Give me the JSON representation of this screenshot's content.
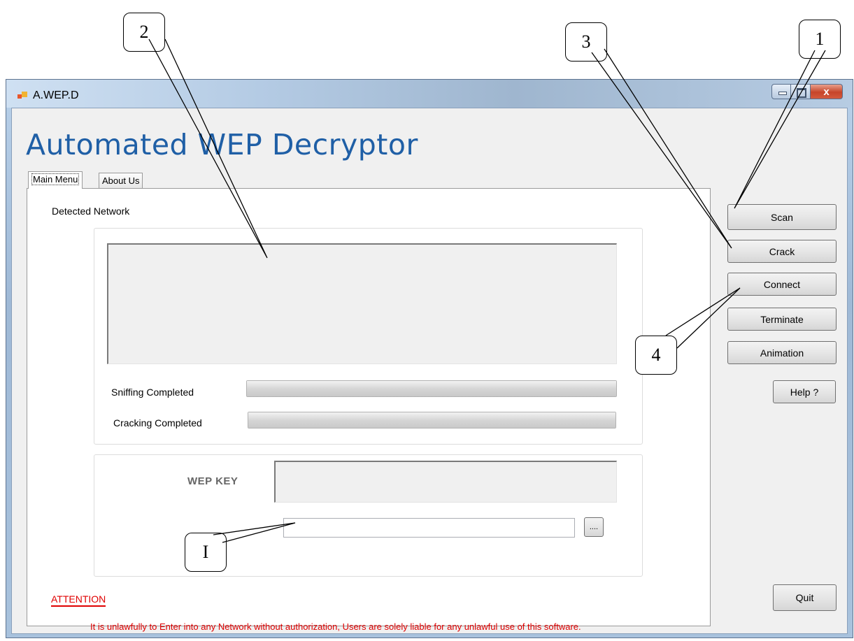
{
  "window": {
    "title": "A.WEP.D",
    "close_glyph": "x"
  },
  "app": {
    "heading": "Automated WEP Decryptor"
  },
  "tabs": [
    {
      "label": "Main Menu",
      "active": true
    },
    {
      "label": "About Us",
      "active": false
    }
  ],
  "main": {
    "detected_network_label": "Detected Network",
    "sniffing_label": "Sniffing Completed",
    "sniffing_progress": 1.0,
    "cracking_label": "Cracking Completed",
    "cracking_progress": 1.0,
    "wep_key_label": "WEP KEY",
    "wep_key_value": "",
    "file_path_value": "",
    "browse_label": "...."
  },
  "side_buttons": {
    "scan": "Scan",
    "crack": "Crack",
    "connect": "Connect",
    "terminate": "Terminate",
    "animation": "Animation",
    "help": "Help ?",
    "quit": "Quit"
  },
  "attention": {
    "title": "ATTENTION",
    "text": "It is unlawfully to Enter into any Network without authorization, Users are solely liable for any unlawful use of this software."
  },
  "callouts": [
    "1",
    "2",
    "3",
    "4",
    "I"
  ],
  "colors": {
    "heading": "#1f5fa6",
    "attention": "#e00000",
    "callout_line": "#000000"
  }
}
